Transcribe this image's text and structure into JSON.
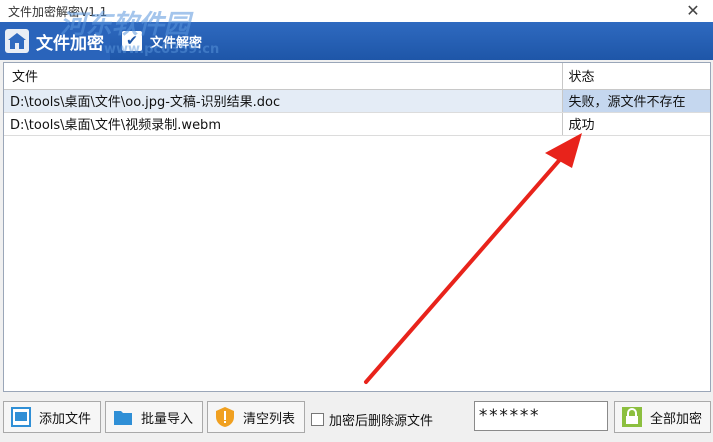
{
  "window": {
    "title": "文件加密解密V1.1",
    "close_glyph": "✕"
  },
  "banner": {
    "tab_encrypt_label": "文件加密",
    "tab_decrypt_label": "文件解密",
    "decrypt_checked": true
  },
  "watermark": {
    "text": "河东软件园",
    "url": "www.pc0359.cn"
  },
  "table": {
    "headers": {
      "file": "文件",
      "status": "状态"
    },
    "rows": [
      {
        "file": "D:\\tools\\桌面\\文件\\oo.jpg-文稿-识别结果.doc",
        "status": "失败，源文件不存在",
        "selected": true
      },
      {
        "file": "D:\\tools\\桌面\\文件\\视频录制.webm",
        "status": "成功",
        "selected": false
      }
    ]
  },
  "toolbar": {
    "add_file_label": "添加文件",
    "batch_import_label": "批量导入",
    "clear_list_label": "清空列表",
    "delete_after_encrypt_label": "加密后删除源文件",
    "delete_after_encrypt_checked": false,
    "password_value": "******",
    "encrypt_all_label": "全部加密"
  },
  "colors": {
    "banner_blue": "#1e56a8",
    "selection": "#c5d7ef",
    "arrow_red": "#e8231b"
  }
}
